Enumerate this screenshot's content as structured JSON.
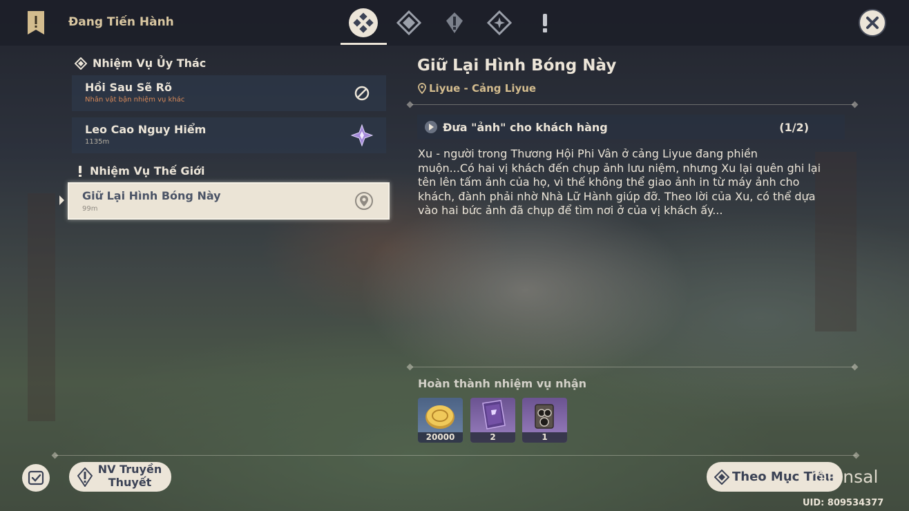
{
  "header": {
    "title": "Đang Tiến Hành",
    "tabs": [
      "all-quests-icon",
      "archon-quest-icon",
      "world-quest-icon",
      "commission-icon",
      "event-quest-icon"
    ],
    "active_tab": 0
  },
  "quest_list": {
    "sections": [
      {
        "label": "Nhiệm Vụ Ủy Thác",
        "items": [
          {
            "name": "Hồi Sau Sẽ Rõ",
            "sub": "Nhân vật bận nhiệm vụ khác",
            "icon": "blocked-icon"
          },
          {
            "name": "Leo Cao Nguy Hiểm",
            "sub": "1135m",
            "icon": "commission-marker-icon"
          }
        ]
      },
      {
        "label": "Nhiệm Vụ Thế Giới",
        "items": [
          {
            "name": "Giữ Lại Hình Bóng Này",
            "sub": "99m",
            "icon": "location-pin-icon",
            "selected": true
          }
        ]
      }
    ]
  },
  "detail": {
    "title": "Giữ Lại Hình Bóng Này",
    "location": "Liyue - Cảng Liyue",
    "objective": {
      "text": "Đưa \"ảnh\" cho khách hàng",
      "progress": "(1/2)"
    },
    "description": [
      "Xu - người trong Thương Hội Phi Vân ở cảng Liyue đang phiền",
      "muộn...Có hai vị khách đến chụp ảnh lưu niệm, nhưng Xu lại quên ghi lại",
      "tên lên tấm ảnh của họ, vì thế không thể giao ảnh in từ máy ảnh cho",
      "khách, đành phải nhờ Nhà Lữ Hành giúp đỡ. Theo lời của Xu, có thể dựa",
      "vào hai bức ảnh đã chụp để tìm nơi ở của vị khách ấy..."
    ],
    "rewards_label": "Hoàn thành nhiệm vụ nhận",
    "rewards": [
      {
        "icon": "mora-coin-icon",
        "count": "20000",
        "color": "#5d7391"
      },
      {
        "icon": "heros-wit-book-icon",
        "count": "2",
        "color": "#7a5f9c"
      },
      {
        "icon": "camera-icon",
        "count": "1",
        "color": "#7a5f9c"
      }
    ]
  },
  "footer": {
    "story_button": "NV Truyền Thuyết",
    "track_button": "Theo Mục Tiêu",
    "watermark": "@ainsal",
    "uid": "UID: 809534377"
  }
}
